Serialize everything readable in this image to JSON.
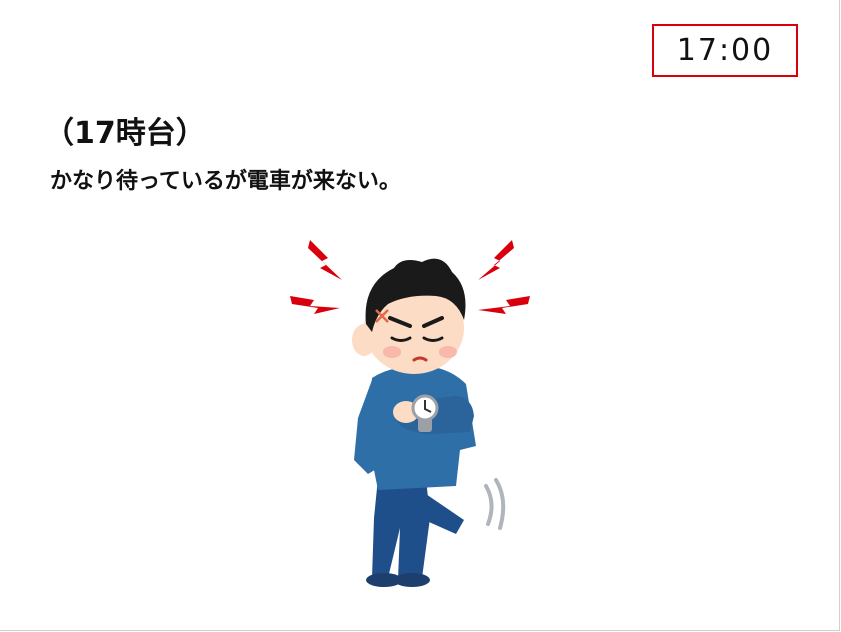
{
  "slide": {
    "time_label": "17:00",
    "heading": "（17時台）",
    "description": "かなり待っているが電車が来ない。"
  },
  "colors": {
    "time_box_border": "#d9000d",
    "anger_marks": "#d9000d",
    "shirt": "#2f6fa8",
    "pants": "#1f4f8a",
    "hair": "#1a1a1a",
    "skin": "#fcdcc4"
  },
  "illustration": {
    "icon": "impatient-man-checking-watch-icon"
  }
}
